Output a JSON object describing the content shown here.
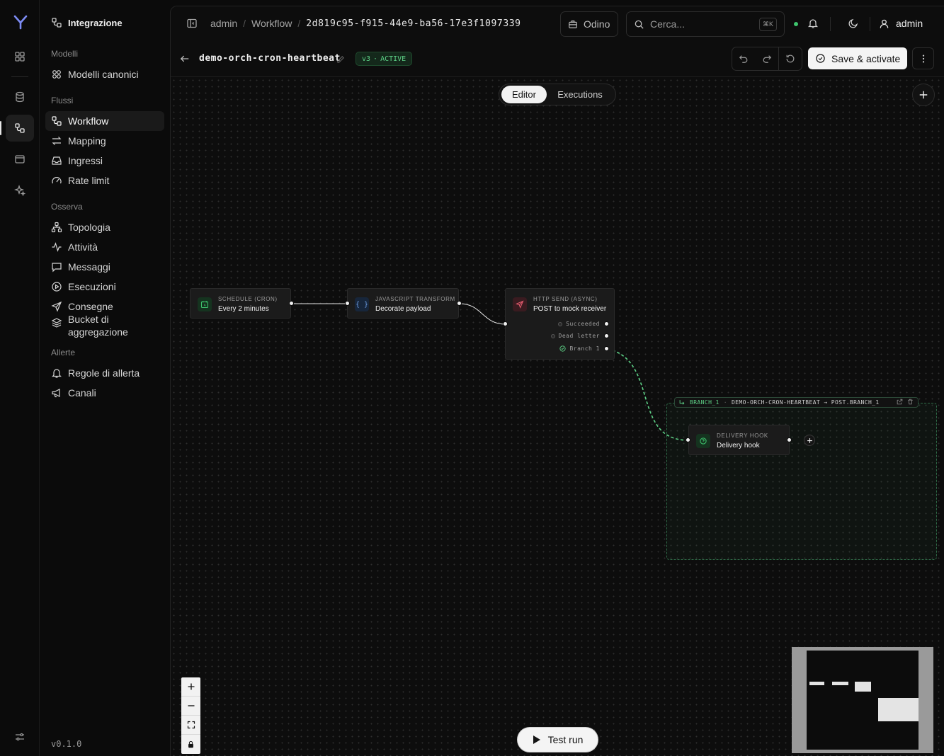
{
  "app": {
    "brand_logo": "Y",
    "version": "v0.1.0"
  },
  "rail": {
    "icons": [
      "dashboard-icon",
      "database-icon",
      "workflow-icon",
      "browser-icon",
      "sparkles-icon",
      "settings-sliders-icon"
    ]
  },
  "sidebar": {
    "title": "Integrazione",
    "groups": [
      {
        "label": "Modelli",
        "items": [
          {
            "label": "Modelli canonici",
            "icon": "models-icon"
          }
        ]
      },
      {
        "label": "Flussi",
        "items": [
          {
            "label": "Workflow",
            "icon": "workflow-icon",
            "active": true
          },
          {
            "label": "Mapping",
            "icon": "arrows-icon"
          },
          {
            "label": "Ingressi",
            "icon": "inbox-icon"
          },
          {
            "label": "Rate limit",
            "icon": "gauge-icon"
          }
        ]
      },
      {
        "label": "Osserva",
        "items": [
          {
            "label": "Topologia",
            "icon": "topology-icon"
          },
          {
            "label": "Attività",
            "icon": "activity-icon"
          },
          {
            "label": "Messaggi",
            "icon": "message-icon"
          },
          {
            "label": "Esecuzioni",
            "icon": "play-circle-icon"
          },
          {
            "label": "Consegne",
            "icon": "send-icon"
          },
          {
            "label": "Bucket di aggregazione",
            "icon": "layers-icon"
          }
        ]
      },
      {
        "label": "Allerte",
        "items": [
          {
            "label": "Regole di allerta",
            "icon": "bell-icon"
          },
          {
            "label": "Canali",
            "icon": "megaphone-icon"
          }
        ]
      }
    ]
  },
  "topbar": {
    "breadcrumb": [
      "admin",
      "Workflow",
      "2d819c95-f915-44e9-ba56-17e3f1097339"
    ],
    "tenant": "Odino",
    "search_placeholder": "Cerca...",
    "search_shortcut": "⌘K",
    "status_color": "#3ec46d",
    "user": "admin"
  },
  "workflow": {
    "name": "demo-orch-cron-heartbeat",
    "version": "v3",
    "status": "ACTIVE",
    "save_label": "Save & activate"
  },
  "canvas": {
    "tabs": [
      "Editor",
      "Executions"
    ],
    "active_tab": "Editor",
    "test_run_label": "Test run",
    "nodes": [
      {
        "kind": "SCHEDULE (CRON)",
        "title": "Every 2 minutes",
        "accent": "#3ec46d"
      },
      {
        "kind": "JAVASCRIPT TRANSFORM",
        "title": "Decorate payload",
        "accent": "#5b8fd6"
      },
      {
        "kind": "HTTP SEND (ASYNC)",
        "title": "POST to mock receiver",
        "accent": "#e05b6d",
        "outputs": [
          "Succeeded",
          "Dead letter",
          "Branch 1"
        ]
      },
      {
        "kind": "DELIVERY HOOK",
        "title": "Delivery hook",
        "accent": "#3ec46d"
      }
    ],
    "branch_group": {
      "label": "BRANCH_1",
      "path": "DEMO-ORCH-CRON-HEARTBEAT → POST.BRANCH_1"
    }
  }
}
